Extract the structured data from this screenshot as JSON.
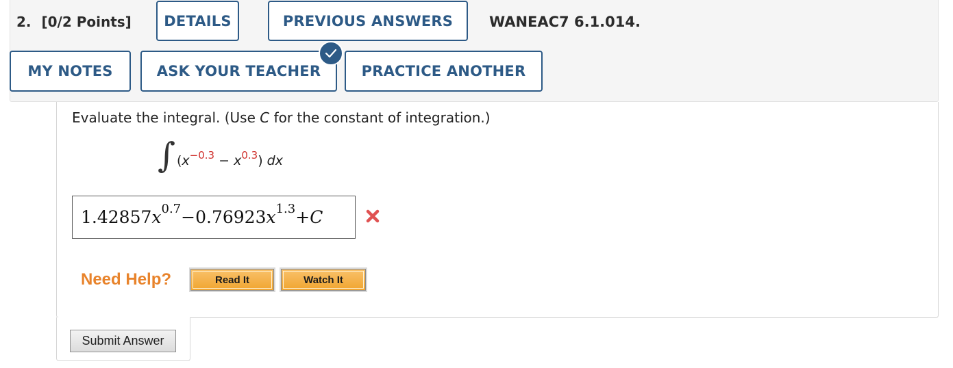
{
  "question": {
    "number_label": "2.",
    "points_label": "[0/2 Points]",
    "assignment_id": "WANEAC7 6.1.014."
  },
  "toolbar": {
    "details_label": "DETAILS",
    "previous_answers_label": "PREVIOUS ANSWERS",
    "my_notes_label": "MY NOTES",
    "ask_teacher_label": "ASK YOUR TEACHER",
    "practice_another_label": "PRACTICE ANOTHER",
    "badge_icon": "check-icon"
  },
  "problem": {
    "instruction_pre": "Evaluate the integral. (Use ",
    "instruction_var": "C",
    "instruction_post": " for the constant of integration.)",
    "integral_symbol": "∫",
    "integrand": {
      "open": "(",
      "var1": "x",
      "exp1": "−0.3",
      "minus": " − ",
      "var2": "x",
      "exp2": "0.3",
      "close": ") ",
      "dx": "dx"
    }
  },
  "answer": {
    "coef1": "1.42857",
    "var1": "x",
    "exp1": "0.7",
    "minus": " − ",
    "coef2": "0.76923",
    "var2": "x",
    "exp2": "1.3",
    "plus": " + ",
    "const": "C",
    "status": "incorrect",
    "status_icon": "x-mark-icon",
    "status_color": "#e05252"
  },
  "help": {
    "label": "Need Help?",
    "read_label": "Read It",
    "watch_label": "Watch It"
  },
  "submit": {
    "label": "Submit Answer"
  },
  "colors": {
    "accent": "#2d5a86",
    "exponent": "#d0312d",
    "help_text": "#e8832b"
  }
}
